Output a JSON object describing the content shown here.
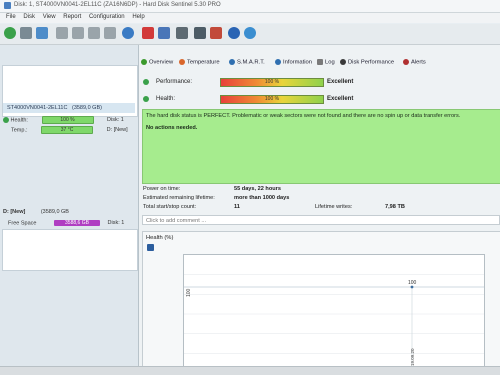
{
  "window": {
    "title": "Disk: 1, ST4000VN0041-2EL11C (ZA16N6DP) - Hard Disk Sentinel 5.30 PRO"
  },
  "menu": [
    "File",
    "Disk",
    "View",
    "Report",
    "Configuration",
    "Help"
  ],
  "sidebar": {
    "disk": {
      "name": "ST4000VN0041-2EL11C",
      "size": "(3589,0 GB)",
      "health_label": "Health:",
      "health_value": "100 %",
      "disk_index": "Disk: 1",
      "temp_label": "Temp.:",
      "temp_value": "37 °C",
      "drive": "D: [New]"
    },
    "volume": {
      "drive": "D: [New]",
      "size": "(3589,0 GB",
      "free_label": "Free Space",
      "free_value": "3588,6 GB",
      "disk_index": "Disk: 1"
    }
  },
  "tabs": [
    {
      "label": "Overview",
      "color": "#3b9a2d"
    },
    {
      "label": "Temperature",
      "color": "#d9662b"
    },
    {
      "label": "S.M.A.R.T.",
      "color": "#2f6fb0"
    },
    {
      "label": "Information",
      "color": "#2f6fb0"
    },
    {
      "label": "Log",
      "color": "#7a7a7a"
    },
    {
      "label": "Disk Performance",
      "color": "#3a3a3a"
    },
    {
      "label": "Alerts",
      "color": "#b03030"
    }
  ],
  "overview": {
    "performance_label": "Performance:",
    "performance_value": "100 %",
    "performance_rating": "Excellent",
    "health_label": "Health:",
    "health_value": "100 %",
    "health_rating": "Excellent",
    "status_text": "The hard disk status is PERFECT. Problematic or weak sectors were not found and there are no spin up or data transfer errors.",
    "status_action": "No actions needed.",
    "power_on_label": "Power on time:",
    "power_on_value": "55 days, 22 hours",
    "lifetime_label": "Estimated remaining lifetime:",
    "lifetime_value": "more than 1000 days",
    "startstop_label": "Total start/stop count:",
    "startstop_value": "11",
    "writes_label": "Lifetime writes:",
    "writes_value": "7,98 TB",
    "comment_placeholder": "Click to add comment ...",
    "health_chart_title": "Health (%)"
  },
  "chart_data": {
    "type": "line",
    "title": "Health (%)",
    "ylabel": "100",
    "x": [
      "2019.09.20"
    ],
    "series": [
      {
        "values": [
          100
        ]
      }
    ],
    "point_label": "100"
  }
}
